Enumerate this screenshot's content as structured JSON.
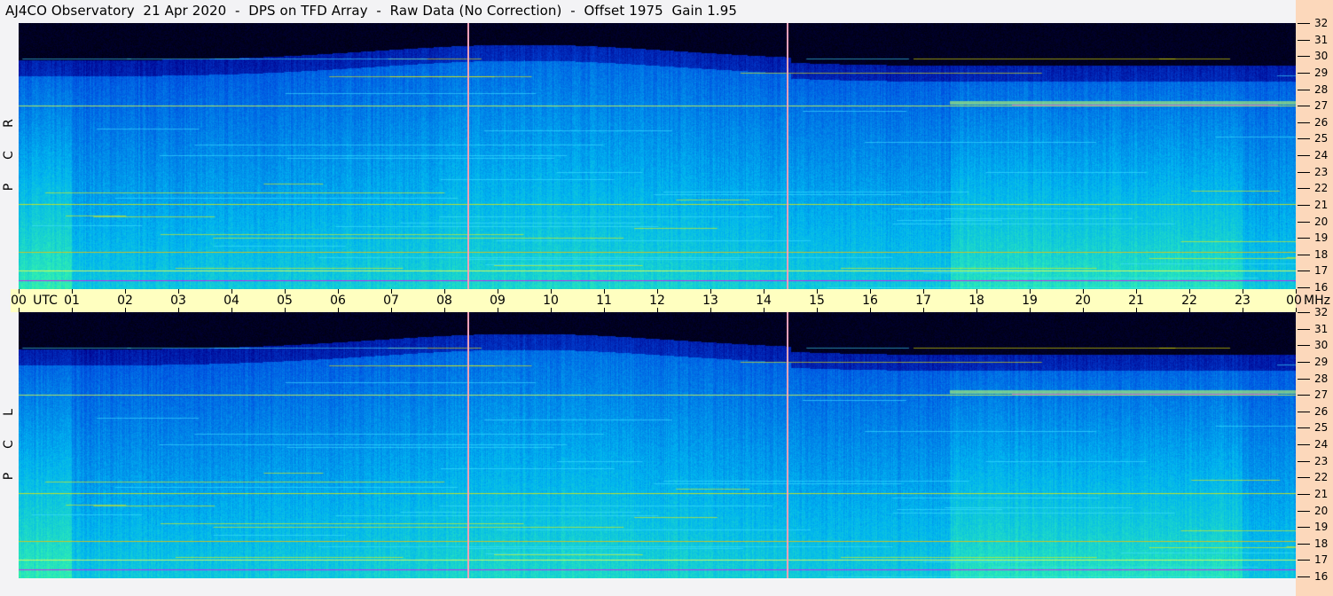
{
  "title": "AJ4CO Observatory  21 Apr 2020  -  DPS on TFD Array  -  Raw Data (No Correction)  -  Offset 1975  Gain 1.95",
  "chart_data": {
    "type": "heatmap",
    "title": "AJ4CO Observatory  21 Apr 2020  -  DPS on TFD Array  -  Raw Data (No Correction)  -  Offset 1975  Gain 1.95",
    "xlabel": "UTC",
    "ylabel": "MHz",
    "x_ticks": [
      "00",
      "01",
      "02",
      "03",
      "04",
      "05",
      "06",
      "07",
      "08",
      "09",
      "10",
      "11",
      "12",
      "13",
      "14",
      "15",
      "16",
      "17",
      "18",
      "19",
      "20",
      "21",
      "22",
      "23",
      "00"
    ],
    "x_unit_label": "UTC",
    "y_unit_label": "MHz",
    "y_ticks": [
      32,
      31,
      30,
      29,
      28,
      27,
      26,
      25,
      24,
      23,
      22,
      21,
      20,
      19,
      18,
      17,
      16
    ],
    "xlim_hours": [
      0,
      24
    ],
    "ylim_mhz": [
      16,
      32
    ],
    "panels": [
      {
        "name": "RCP",
        "label": [
          "R",
          "C",
          "P"
        ]
      },
      {
        "name": "LCP",
        "label": [
          "L",
          "C",
          "P"
        ]
      }
    ],
    "markers_utc_hours": [
      8.43,
      14.43
    ],
    "colormap": [
      "#000000",
      "#00008c",
      "#0050e0",
      "#00b4f0",
      "#30f0b0",
      "#f0f000",
      "#ff00ff"
    ]
  }
}
